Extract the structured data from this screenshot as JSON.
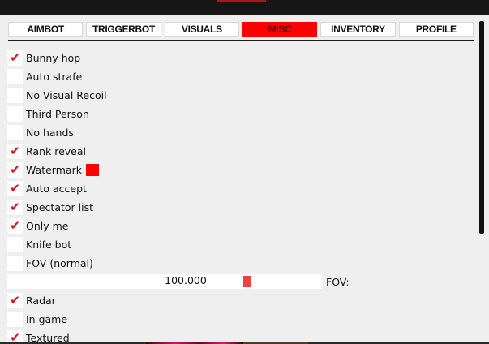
{
  "tabs": [
    {
      "label": "AIMBOT",
      "active": false
    },
    {
      "label": "TRIGGERBOT",
      "active": false
    },
    {
      "label": "VISUALS",
      "active": false
    },
    {
      "label": "MISC",
      "active": true
    },
    {
      "label": "INVENTORY",
      "active": false
    },
    {
      "label": "PROFILE",
      "active": false
    }
  ],
  "options": [
    {
      "label": "Bunny hop",
      "checked": true
    },
    {
      "label": "Auto strafe",
      "checked": false
    },
    {
      "label": "No Visual Recoil",
      "checked": false
    },
    {
      "label": "Third Person",
      "checked": false
    },
    {
      "label": "No hands",
      "checked": false
    },
    {
      "label": "Rank reveal",
      "checked": true
    },
    {
      "label": "Watermark",
      "checked": true,
      "color": "#ff0000"
    },
    {
      "label": "Auto accept",
      "checked": true
    },
    {
      "label": "Spectator list",
      "checked": true
    },
    {
      "label": "Only me",
      "checked": true
    },
    {
      "label": "Knife bot",
      "checked": false
    },
    {
      "label": "FOV (normal)",
      "checked": false
    }
  ],
  "fov_slider": {
    "value_text": "100.000",
    "label": "FOV:",
    "fraction": 0.77
  },
  "options2": [
    {
      "label": "Radar",
      "checked": true
    },
    {
      "label": "In game",
      "checked": false
    },
    {
      "label": "Textured",
      "checked": true
    }
  ],
  "colors": {
    "accent": "#ff0000",
    "check": "#d41010",
    "panel": "#efefef"
  }
}
